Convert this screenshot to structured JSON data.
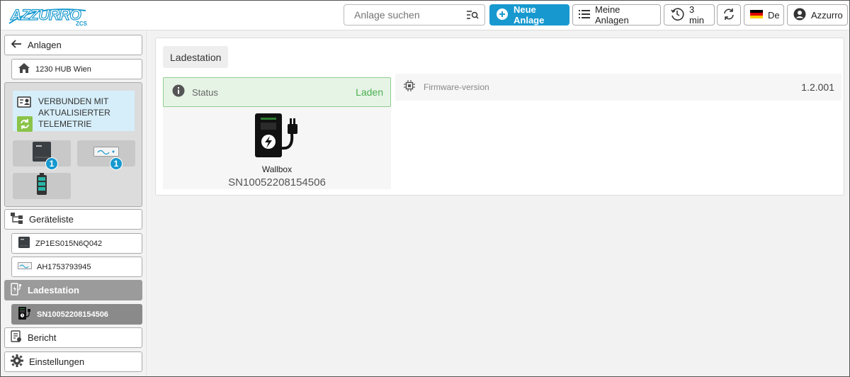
{
  "header": {
    "logo_text": "AZZURRO",
    "logo_sub": "ZCS",
    "search_placeholder": "Anlage suchen",
    "new_button": "Neue Anlage",
    "my_plants_button": "Meine Anlagen",
    "refresh_interval": "3 min",
    "language": "De",
    "user": "Azzurro"
  },
  "sidebar": {
    "back_label": "Anlagen",
    "plant_name": "1230 HUB Wien",
    "telemetry_status": "VERBUNDEN MIT AKTUALISIERTER TELEMETRIE",
    "inverter_count": "1",
    "meter_count": "1",
    "device_list_label": "Geräteliste",
    "devices": [
      "ZP1ES015N6Q042",
      "AH1753793945"
    ],
    "charging_label": "Ladestation",
    "charger_serial": "SN10052208154506",
    "report_label": "Bericht",
    "settings_label": "Einstellungen"
  },
  "main": {
    "title": "Ladestation",
    "status_label": "Status",
    "status_value": "Laden",
    "device_name": "Wallbox",
    "device_serial": "SN10052208154506",
    "firmware_label": "Firmware-version",
    "firmware_value": "1.2.001"
  },
  "colors": {
    "accent": "#1799cf",
    "status_green": "#4caf50",
    "status_bg": "#e6f4e6",
    "sync_green": "#8bc34a"
  }
}
